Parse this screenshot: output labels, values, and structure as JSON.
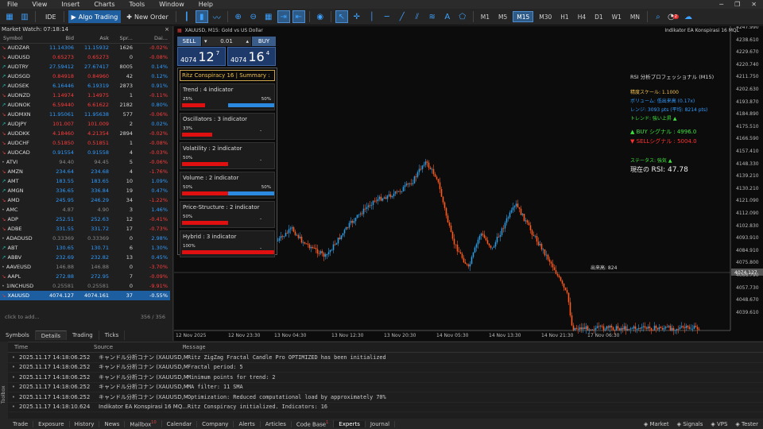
{
  "menu": [
    "File",
    "View",
    "Insert",
    "Charts",
    "Tools",
    "Window",
    "Help"
  ],
  "toolbar": {
    "ide": "IDE",
    "algo": "Algo Trading",
    "new_order": "New Order",
    "timeframes": [
      "M1",
      "M5",
      "M15",
      "M30",
      "H1",
      "H4",
      "D1",
      "W1",
      "MN"
    ],
    "active_tf": "M15",
    "alerts_badge": "2"
  },
  "market_watch": {
    "title": "Market Watch: 07:18:14",
    "columns": [
      "Symbol",
      "Bid",
      "Ask",
      "Spr...",
      "Dai..."
    ],
    "rows": [
      [
        "AUDZAR",
        "11.14306",
        "11.15932",
        "1626",
        "-0.02%",
        "up",
        "dn"
      ],
      [
        "AUDUSD",
        "0.65273",
        "0.65273",
        "0",
        "-0.08%",
        "dn",
        "dn"
      ],
      [
        "AUDTRY",
        "27.59412",
        "27.67417",
        "8005",
        "0.14%",
        "up",
        "up"
      ],
      [
        "AUDSGD",
        "0.84918",
        "0.84960",
        "42",
        "0.12%",
        "dn",
        "up"
      ],
      [
        "AUDSEK",
        "6.16446",
        "6.19319",
        "2873",
        "0.91%",
        "up",
        "up"
      ],
      [
        "AUDNZD",
        "1.14974",
        "1.14975",
        "1",
        "-0.11%",
        "dn",
        "dn"
      ],
      [
        "AUDNOK",
        "6.59440",
        "6.61622",
        "2182",
        "0.80%",
        "dn",
        "up"
      ],
      [
        "AUDMXN",
        "11.95061",
        "11.95638",
        "577",
        "-0.06%",
        "up",
        "dn"
      ],
      [
        "AUDJPY",
        "101.007",
        "101.009",
        "2",
        "0.02%",
        "dn",
        "up"
      ],
      [
        "AUDDKK",
        "4.18460",
        "4.21354",
        "2894",
        "-0.02%",
        "dn",
        "dn"
      ],
      [
        "AUDCHF",
        "0.51850",
        "0.51851",
        "1",
        "-0.08%",
        "dn",
        "dn"
      ],
      [
        "AUDCAD",
        "0.91554",
        "0.91558",
        "4",
        "-0.03%",
        "up",
        "dn"
      ],
      [
        "ATVI",
        "94.40",
        "94.45",
        "5",
        "-0.06%",
        "gr",
        "dn"
      ],
      [
        "AMZN",
        "234.64",
        "234.68",
        "4",
        "-1.76%",
        "up",
        "dn"
      ],
      [
        "AMT",
        "183.55",
        "183.65",
        "10",
        "1.09%",
        "up",
        "up"
      ],
      [
        "AMGN",
        "336.65",
        "336.84",
        "19",
        "0.47%",
        "up",
        "up"
      ],
      [
        "AMD",
        "245.95",
        "246.29",
        "34",
        "-1.22%",
        "up",
        "dn"
      ],
      [
        "AMC",
        "4.87",
        "4.90",
        "3",
        "1.46%",
        "gr",
        "up"
      ],
      [
        "ADP",
        "252.51",
        "252.63",
        "12",
        "-0.41%",
        "up",
        "dn"
      ],
      [
        "ADBE",
        "331.55",
        "331.72",
        "17",
        "-0.73%",
        "up",
        "dn"
      ],
      [
        "ADADUSD",
        "0.33369",
        "0.33369",
        "0",
        "2.98%",
        "gr",
        "up"
      ],
      [
        "ABT",
        "130.65",
        "130.71",
        "6",
        "1.30%",
        "up",
        "up"
      ],
      [
        "ABBV",
        "232.69",
        "232.82",
        "13",
        "0.45%",
        "up",
        "up"
      ],
      [
        "AAVEUSD",
        "146.88",
        "146.88",
        "0",
        "-3.70%",
        "gr",
        "dn"
      ],
      [
        "AAPL",
        "272.88",
        "272.95",
        "7",
        "-0.09%",
        "up",
        "dn"
      ],
      [
        "1INCHUSD",
        "0.25581",
        "0.25581",
        "0",
        "-9.91%",
        "gr",
        "dn"
      ],
      [
        "XAUUSD",
        "4074.127",
        "4074.161",
        "37",
        "-0.55%",
        "sel",
        "dn"
      ]
    ],
    "add_text": "click to add...",
    "count": "356 / 356",
    "tabs": [
      "Symbols",
      "Details",
      "Trading",
      "Ticks"
    ]
  },
  "chart": {
    "title": "XAUUSD, M15:  Gold vs US Dollar",
    "indicator_name": "Indikator EA Konspirasi 16 MQL",
    "sell": "SELL",
    "buy": "BUY",
    "lot": "0.01",
    "sell_price_small": "4074",
    "sell_price_big": "12",
    "sell_price_sup": "7",
    "buy_price_small": "4074",
    "buy_price_big": "16",
    "buy_price_sup": "4",
    "price_line_label": "出来高: 824",
    "y_ticks": [
      "4247.990",
      "4238.610",
      "4229.670",
      "4220.740",
      "4211.750",
      "4202.630",
      "4193.870",
      "4184.890",
      "4175.510",
      "4166.590",
      "4157.410",
      "4148.330",
      "4139.210",
      "4130.210",
      "4121.090",
      "4112.090",
      "4102.830",
      "4093.910",
      "4084.910",
      "4075.800",
      "4066.790",
      "4057.730",
      "4048.670",
      "4039.610"
    ],
    "x_ticks": [
      "12 Nov 2025",
      "12 Nov 23:30",
      "13 Nov 04:30",
      "13 Nov 12:30",
      "13 Nov 20:30",
      "14 Nov 05:30",
      "14 Nov 13:30",
      "14 Nov 21:30",
      "17 Nov 06:30"
    ],
    "current_price": "4074.127"
  },
  "ritz": {
    "title": "Ritz Conspiracy 16 | Summary :",
    "blocks": [
      {
        "title": "Trend : 4 indicator",
        "left": "25%",
        "right": "50%",
        "dash": "",
        "red": 0.25,
        "blue": 0.5
      },
      {
        "title": "Oscillators : 3 indicator",
        "left": "33%",
        "right": "",
        "dash": "-",
        "red": 0.33,
        "blue": 0
      },
      {
        "title": "Volatility : 2 indicator",
        "left": "50%",
        "right": "",
        "dash": "-",
        "red": 0.5,
        "blue": 0
      },
      {
        "title": "Volume : 2 indicator",
        "left": "50%",
        "right": "50%",
        "dash": "",
        "red": 0.5,
        "blue": 0.5
      },
      {
        "title": "Price-Structure : 2 indicator",
        "left": "50%",
        "right": "",
        "dash": "-",
        "red": 0.5,
        "blue": 0
      },
      {
        "title": "Hybrid : 3 indicator",
        "left": "100%",
        "right": "",
        "dash": "-",
        "red": 1.0,
        "blue": 0
      }
    ]
  },
  "rsi_panel": {
    "title": "RSI 分析プロフェッショナル (M15)",
    "lines": [
      {
        "text": "精度スケール: 1.1000",
        "color": "#f0c050"
      },
      {
        "text": "ボリューム: 低出来高 (0.17x)",
        "color": "#2f9bff"
      },
      {
        "text": "レンジ: 3093 pts (平均: 8214 pts)",
        "color": "#2f9bff"
      },
      {
        "text": "トレンド: 強い上昇 ▲",
        "color": "#40e040"
      }
    ],
    "buy_signal": "▲ BUY シグナル : 4996.0",
    "sell_signal": "▼ SELLシグナル : 5004.0",
    "status": "ステータス: 強気 ▲",
    "current_label": "現在の",
    "rsi_value": "RSI: 47.78"
  },
  "journal": {
    "columns": [
      "Time",
      "Source",
      "Message"
    ],
    "rows": [
      [
        "2025.11.17 14:18:06.252",
        "キャンドル分析コナン (XAUUSD,M...",
        "Ritz ZigZag Fractal Candle Pro OPTIMIZED has been initialized"
      ],
      [
        "2025.11.17 14:18:06.252",
        "キャンドル分析コナン (XAUUSD,M...",
        "Fractal period: 5"
      ],
      [
        "2025.11.17 14:18:06.252",
        "キャンドル分析コナン (XAUUSD,M...",
        "Minimum points for trend: 2"
      ],
      [
        "2025.11.17 14:18:06.252",
        "キャンドル分析コナン (XAUUSD,M...",
        "MA filter: 11 SMA"
      ],
      [
        "2025.11.17 14:18:06.252",
        "キャンドル分析コナン (XAUUSD,M...",
        "Optimization: Reduced computational load by approximately 70%"
      ],
      [
        "2025.11.17 14:18:10.624",
        "Indikator EA Konspirasi 16 MQ...",
        "Ritz Conspiracy initialized. Indicators: 16"
      ]
    ],
    "side_label": "Toolbox"
  },
  "bottom_tabs": [
    "Trade",
    "Exposure",
    "History",
    "News",
    "Mailbox",
    "Calendar",
    "Company",
    "Alerts",
    "Articles",
    "Code Base",
    "Experts",
    "Journal"
  ],
  "bottom_badges": {
    "Mailbox": "10",
    "Code Base": "1"
  },
  "active_bottom_tab": "Experts",
  "bottom_right": [
    "Market",
    "Signals",
    "VPS",
    "Tester"
  ]
}
